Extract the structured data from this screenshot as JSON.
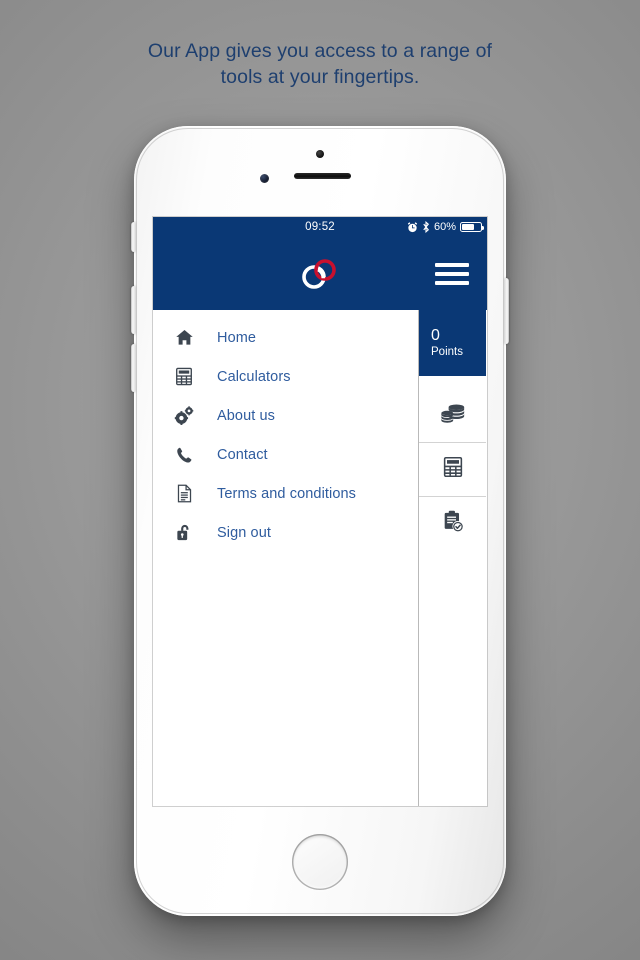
{
  "caption": {
    "line1": "Our App gives you access to a range of",
    "line2": "tools at your fingertips."
  },
  "colors": {
    "brand_navy": "#0a3875",
    "logo_red": "#c8102e",
    "logo_white": "#ffffff",
    "menu_text": "#2f5c9e",
    "icon_gray": "#3d4650",
    "page_background": "#8e8e8e",
    "caption_text": "#1e3f6f"
  },
  "statusbar": {
    "time": "09:52",
    "battery_percent": "60%",
    "battery_level": 60,
    "icons": [
      "alarm-icon",
      "bluetooth-icon",
      "battery-icon"
    ]
  },
  "appbar": {
    "logo_name": "interlocking-rings-logo",
    "menu_button_name": "hamburger-menu-button"
  },
  "drawer": {
    "items": [
      {
        "label": "Home",
        "icon": "home-icon"
      },
      {
        "label": "Calculators",
        "icon": "calculator-icon"
      },
      {
        "label": "About us",
        "icon": "gears-icon"
      },
      {
        "label": "Contact",
        "icon": "phone-icon"
      },
      {
        "label": "Terms and conditions",
        "icon": "document-icon"
      },
      {
        "label": "Sign out",
        "icon": "unlocked-padlock-icon"
      }
    ]
  },
  "rail": {
    "points": {
      "value": "0",
      "label": "Points"
    },
    "shortcuts": [
      {
        "icon": "coins-stack-icon"
      },
      {
        "icon": "calculator-icon"
      },
      {
        "icon": "clipboard-check-icon"
      }
    ]
  },
  "device": {
    "hardware": [
      "silent-switch",
      "volume-up-button",
      "volume-down-button",
      "power-button",
      "home-button",
      "front-camera",
      "proximity-sensor",
      "earpiece-speaker"
    ]
  }
}
